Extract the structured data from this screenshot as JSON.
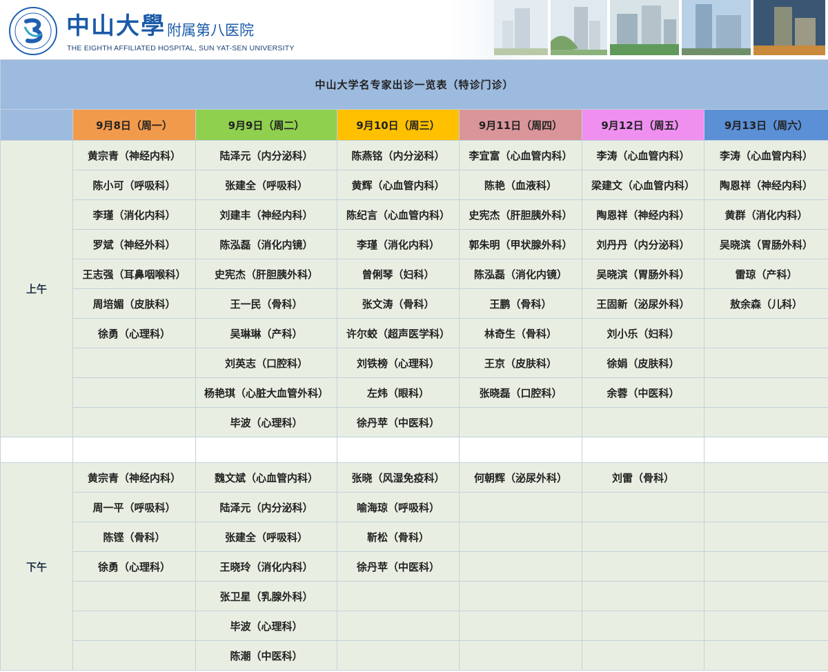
{
  "header": {
    "brand_cn": "中山大學",
    "brand_sub": "附属第八医院",
    "brand_en": "THE EIGHTH AFFILIATED HOSPITAL, SUN YAT-SEN UNIVERSITY"
  },
  "table": {
    "title": "中山大学名专家出诊一览表（特诊门诊）",
    "days": [
      {
        "label": "9月8日（周一）",
        "color": "#f29a4b"
      },
      {
        "label": "9月9日（周二）",
        "color": "#8fd04f"
      },
      {
        "label": "9月10日（周三）",
        "color": "#ffc000"
      },
      {
        "label": "9月11日（周四）",
        "color": "#d9959a"
      },
      {
        "label": "9月12日（周五）",
        "color": "#ef8ff0"
      },
      {
        "label": "9月13日（周六）",
        "color": "#5b8fd6"
      }
    ],
    "morning": {
      "label": "上午",
      "rows": [
        [
          "黄宗青（神经内科）",
          "陆泽元（内分泌科）",
          "陈燕铭（内分泌科）",
          "李宜富（心血管内科）",
          "李涛（心血管内科）",
          "李涛（心血管内科）"
        ],
        [
          "陈小可（呼吸科）",
          "张建全（呼吸科）",
          "黄辉（心血管内科）",
          "陈艳（血液科）",
          "梁建文（心血管内科）",
          "陶恩祥（神经内科）"
        ],
        [
          "李瑾（消化内科）",
          "刘建丰（神经内科）",
          "陈纪言（心血管内科）",
          "史宪杰（肝胆胰外科）",
          "陶恩祥（神经内科）",
          "黄群（消化内科）"
        ],
        [
          "罗斌（神经外科）",
          "陈泓磊（消化内镜）",
          "李瑾（消化内科）",
          "郭朱明（甲状腺外科）",
          "刘丹丹（内分泌科）",
          "吴晓滨（胃肠外科）"
        ],
        [
          "王志强（耳鼻咽喉科）",
          "史宪杰（肝胆胰外科）",
          "曾俐琴（妇科）",
          "陈泓磊（消化内镜）",
          "吴晓滨（胃肠外科）",
          "雷琼（产科）"
        ],
        [
          "周培媚（皮肤科）",
          "王一民（骨科）",
          "张文涛（骨科）",
          "王鹏（骨科）",
          "王固新（泌尿外科）",
          "敖余森（儿科）"
        ],
        [
          "徐勇（心理科）",
          "吴琳琳（产科）",
          "许尔蛟（超声医学科）",
          "林奇生（骨科）",
          "刘小乐（妇科）",
          ""
        ],
        [
          "",
          "刘英志（口腔科）",
          "刘铁榜（心理科）",
          "王京（皮肤科）",
          "徐娟（皮肤科）",
          ""
        ],
        [
          "",
          "杨艳琪（心脏大血管外科）",
          "左炜（眼科）",
          "张晓磊（口腔科）",
          "余蓉（中医科）",
          ""
        ],
        [
          "",
          "毕波（心理科）",
          "徐丹苹（中医科）",
          "",
          "",
          ""
        ]
      ]
    },
    "afternoon": {
      "label": "下午",
      "rows": [
        [
          "黄宗青（神经内科）",
          "魏文斌（心血管内科）",
          "张晓（风湿免疫科）",
          "何朝辉（泌尿外科）",
          "刘雷（骨科）",
          ""
        ],
        [
          "周一平（呼吸科）",
          "陆泽元（内分泌科）",
          "喻海琼（呼吸科）",
          "",
          "",
          ""
        ],
        [
          "陈铿（骨科）",
          "张建全（呼吸科）",
          "靳松（骨科）",
          "",
          "",
          ""
        ],
        [
          "徐勇（心理科）",
          "王晓玲（消化内科）",
          "徐丹苹（中医科）",
          "",
          "",
          ""
        ],
        [
          "",
          "张卫星（乳腺外科）",
          "",
          "",
          "",
          ""
        ],
        [
          "",
          "毕波（心理科）",
          "",
          "",
          "",
          ""
        ],
        [
          "",
          "陈潮（中医科）",
          "",
          "",
          "",
          ""
        ]
      ]
    }
  }
}
